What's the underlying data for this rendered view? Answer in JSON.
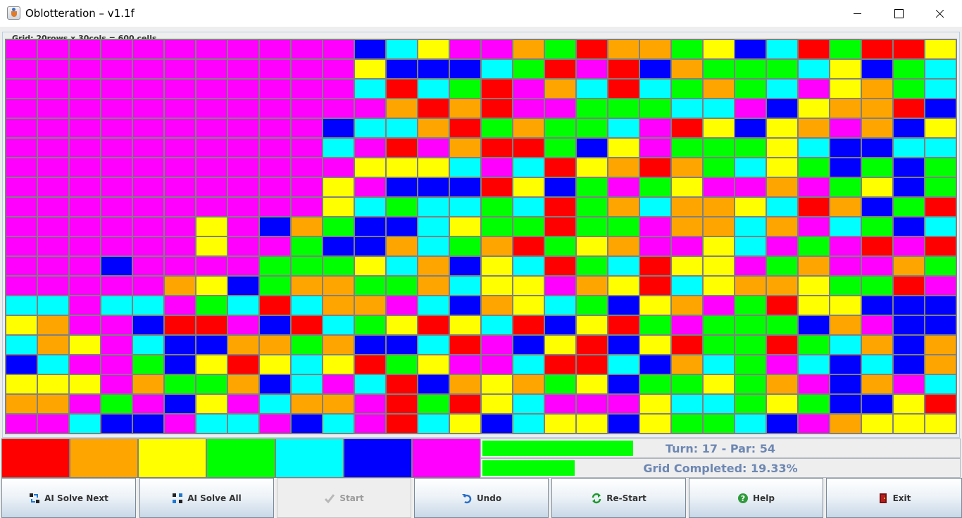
{
  "window": {
    "title": "Oblotteration – v1.1f"
  },
  "grid": {
    "caption": "Grid: 20rows x 30cols  = 600 cells",
    "rows": 20,
    "cols": 30,
    "palette_codes": {
      "R": "#ff0000",
      "O": "#ffa500",
      "Y": "#ffff00",
      "G": "#00ff00",
      "C": "#00ffff",
      "B": "#0000ff",
      "M": "#ff00ff"
    },
    "cells": [
      "MMMMMMMMMMMBCYMMOGROOGYBCRGRRY",
      "MMMMMMMMMMMYBBBCGRMRBOGGGCYBGC",
      "MMMMMMMMMMMCRCGRMOCRCGOGCMYOGC",
      "MMMMMMMMMMMMORORMMGGGCCMBYOORB",
      "MMMMMMMMMMBCCORGOGGCMRYBYOMOBY",
      "MMMMMMMMMMCMRMORRGBYMGGGYCBBCC",
      "MMMMMMMMMMMYYYCMCRYOROGCYGBGBG",
      "MMMMMMMMMMYMBBBRYBGMGYMMOMGYBG",
      "MMMMMMMMMMYCGCCGCRGOCOOYCROBGR",
      "MMMMMMYMBOGBBCYGGRGGMOOCOMCGBC",
      "MMMMMMYMMGBBOCGORGYOMMYCMGMRMR",
      "MMMBMMMMGGGYCOBYCRGCRYYMGOMMOG",
      "MMMMMOYBGOOGGOCYYMOYRCYOOYGGRM",
      "CCMCCMGCRCOOMCBOYCGBYOMGRYYBB",
      "YOMMBRRMBRCGYRYCRBYRGMGGGBOMBB",
      "COYMCBBOOGOBBCRMBYRBYRGGRGCOBO",
      "BCMMGBYRYCYRGYMMCRRCBOCGMCBCBO",
      "YYYMOGGOBCMCRBOYOGYBGGYGOMBOMC",
      "OOMGMBYMCOOMRGRYCMMMYCCGYGBBYR",
      "MMCBBMCCMBCMRCYBCYYBYGGCBMOYYY"
    ]
  },
  "palette": [
    {
      "name": "red",
      "color": "#ff0000"
    },
    {
      "name": "orange",
      "color": "#ffa500"
    },
    {
      "name": "yellow",
      "color": "#ffff00"
    },
    {
      "name": "green",
      "color": "#00ff00"
    },
    {
      "name": "cyan",
      "color": "#00ffff"
    },
    {
      "name": "blue",
      "color": "#0000ff"
    },
    {
      "name": "magenta",
      "color": "#ff00ff"
    }
  ],
  "status": {
    "turn_text": "Turn: 17  - Par: 54",
    "turn_fraction": 0.3148,
    "completed_text": "Grid Completed: 19.33%",
    "completed_fraction": 0.1933,
    "bar_color": "#00ff00",
    "text_color": "#6d87b2"
  },
  "buttons": [
    {
      "id": "ai-solve-next",
      "label": "AI Solve Next",
      "icon": "ai-step-icon",
      "enabled": true
    },
    {
      "id": "ai-solve-all",
      "label": "AI Solve All",
      "icon": "ai-all-icon",
      "enabled": true
    },
    {
      "id": "start",
      "label": "Start",
      "icon": "checkmark-icon",
      "enabled": false
    },
    {
      "id": "undo",
      "label": "Undo",
      "icon": "undo-icon",
      "enabled": true
    },
    {
      "id": "restart",
      "label": "Re-Start",
      "icon": "refresh-icon",
      "enabled": true
    },
    {
      "id": "help",
      "label": "Help",
      "icon": "help-icon",
      "enabled": true
    },
    {
      "id": "exit",
      "label": "Exit",
      "icon": "exit-icon",
      "enabled": true
    }
  ]
}
